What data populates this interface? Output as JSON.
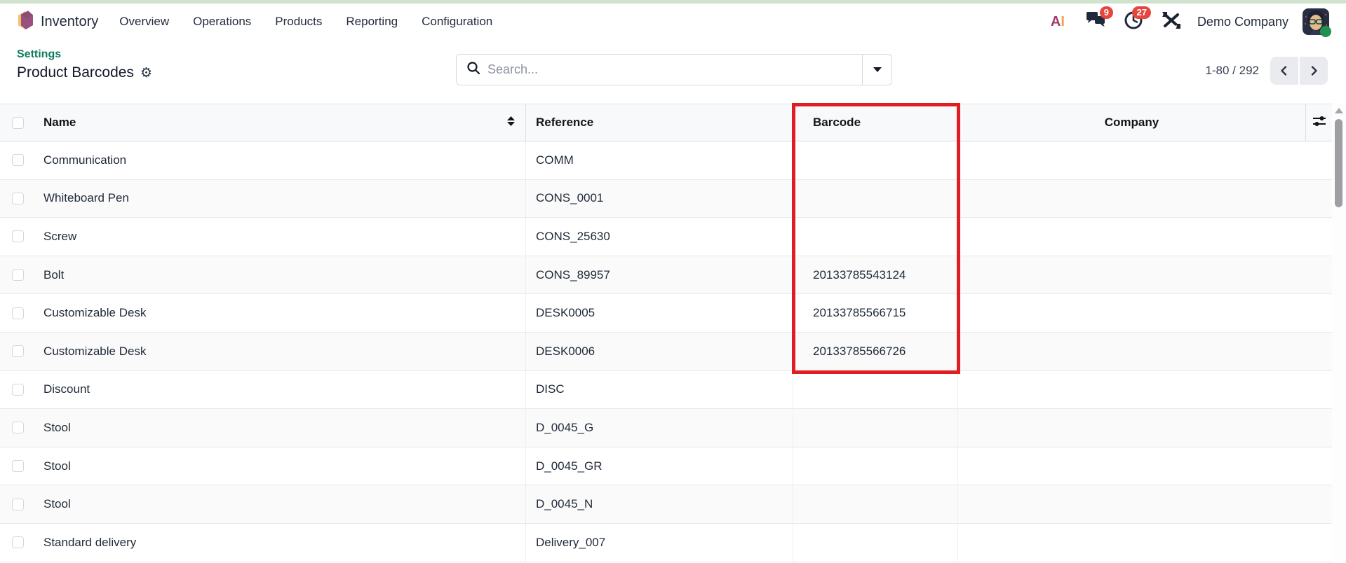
{
  "topbar": {
    "app_name": "Inventory",
    "menu": [
      "Overview",
      "Operations",
      "Products",
      "Reporting",
      "Configuration"
    ],
    "systray": {
      "ai_a": "A",
      "ai_i": "I",
      "messages_badge": "9",
      "activities_badge": "27",
      "company_name": "Demo Company"
    }
  },
  "breadcrumb": {
    "parent": "Settings",
    "current": "Product Barcodes"
  },
  "search": {
    "placeholder": "Search..."
  },
  "pager": {
    "range": "1-80 / 292"
  },
  "table": {
    "columns": {
      "name": "Name",
      "reference": "Reference",
      "barcode": "Barcode",
      "company": "Company"
    },
    "rows": [
      {
        "name": "Communication",
        "reference": "COMM",
        "barcode": "",
        "company": ""
      },
      {
        "name": "Whiteboard Pen",
        "reference": "CONS_0001",
        "barcode": "",
        "company": ""
      },
      {
        "name": "Screw",
        "reference": "CONS_25630",
        "barcode": "",
        "company": ""
      },
      {
        "name": "Bolt",
        "reference": "CONS_89957",
        "barcode": "20133785543124",
        "company": ""
      },
      {
        "name": "Customizable Desk",
        "reference": "DESK0005",
        "barcode": "20133785566715",
        "company": ""
      },
      {
        "name": "Customizable Desk",
        "reference": "DESK0006",
        "barcode": "20133785566726",
        "company": ""
      },
      {
        "name": "Discount",
        "reference": "DISC",
        "barcode": "",
        "company": ""
      },
      {
        "name": "Stool",
        "reference": "D_0045_G",
        "barcode": "",
        "company": ""
      },
      {
        "name": "Stool",
        "reference": "D_0045_GR",
        "barcode": "",
        "company": ""
      },
      {
        "name": "Stool",
        "reference": "D_0045_N",
        "barcode": "",
        "company": ""
      },
      {
        "name": "Standard delivery",
        "reference": "Delivery_007",
        "barcode": "",
        "company": ""
      }
    ]
  },
  "colors": {
    "highlight_red": "#e01d23",
    "link_teal": "#0d7b5f",
    "badge_red": "#e5463d",
    "top_strip_green": "#cfe3cd",
    "status_green": "#219150"
  }
}
